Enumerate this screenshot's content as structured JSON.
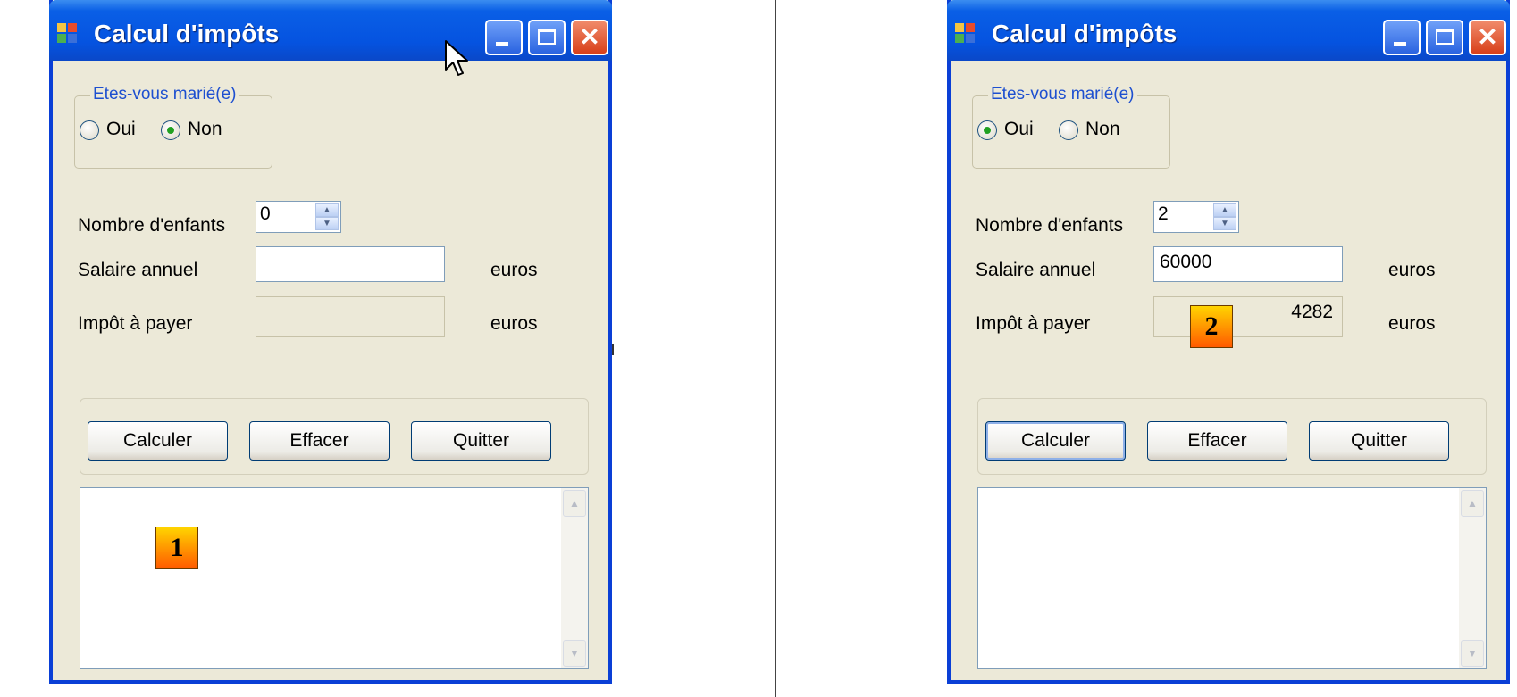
{
  "colors": {
    "titlebar": "#0553e0",
    "window_border": "#0a3fd6",
    "face": "#ece9d8",
    "group_legend": "#1d4fd0",
    "badge_top": "#ffd400",
    "badge_bottom": "#ff5a00",
    "radio_dot": "#21a121"
  },
  "icons": {
    "app": "windows-app-icon",
    "minimize": "minimize-icon",
    "maximize": "maximize-icon",
    "close": "close-icon",
    "spin_up": "chevron-up-icon",
    "spin_down": "chevron-down-icon",
    "cursor": "mouse-pointer-icon"
  },
  "windows": [
    {
      "title": "Calcul d'impôts",
      "close_glyph": "✕",
      "marital": {
        "legend": "Etes-vous marié(e)",
        "oui": "Oui",
        "non": "Non",
        "selected": "non"
      },
      "children": {
        "label": "Nombre d'enfants",
        "value": "0"
      },
      "salary": {
        "label": "Salaire annuel",
        "value": "",
        "units": "euros"
      },
      "tax": {
        "label": "Impôt à payer",
        "value": "",
        "units": "euros"
      },
      "buttons": {
        "calculate": "Calculer",
        "clear": "Effacer",
        "quit": "Quitter"
      },
      "output_text": "",
      "badge": "1"
    },
    {
      "title": "Calcul d'impôts",
      "close_glyph": "✕",
      "marital": {
        "legend": "Etes-vous marié(e)",
        "oui": "Oui",
        "non": "Non",
        "selected": "oui"
      },
      "children": {
        "label": "Nombre d'enfants",
        "value": "2"
      },
      "salary": {
        "label": "Salaire annuel",
        "value": "60000",
        "units": "euros"
      },
      "tax": {
        "label": "Impôt à payer",
        "value": "4282",
        "units": "euros"
      },
      "buttons": {
        "calculate": "Calculer",
        "clear": "Effacer",
        "quit": "Quitter"
      },
      "output_text": "",
      "badge": "2"
    }
  ]
}
